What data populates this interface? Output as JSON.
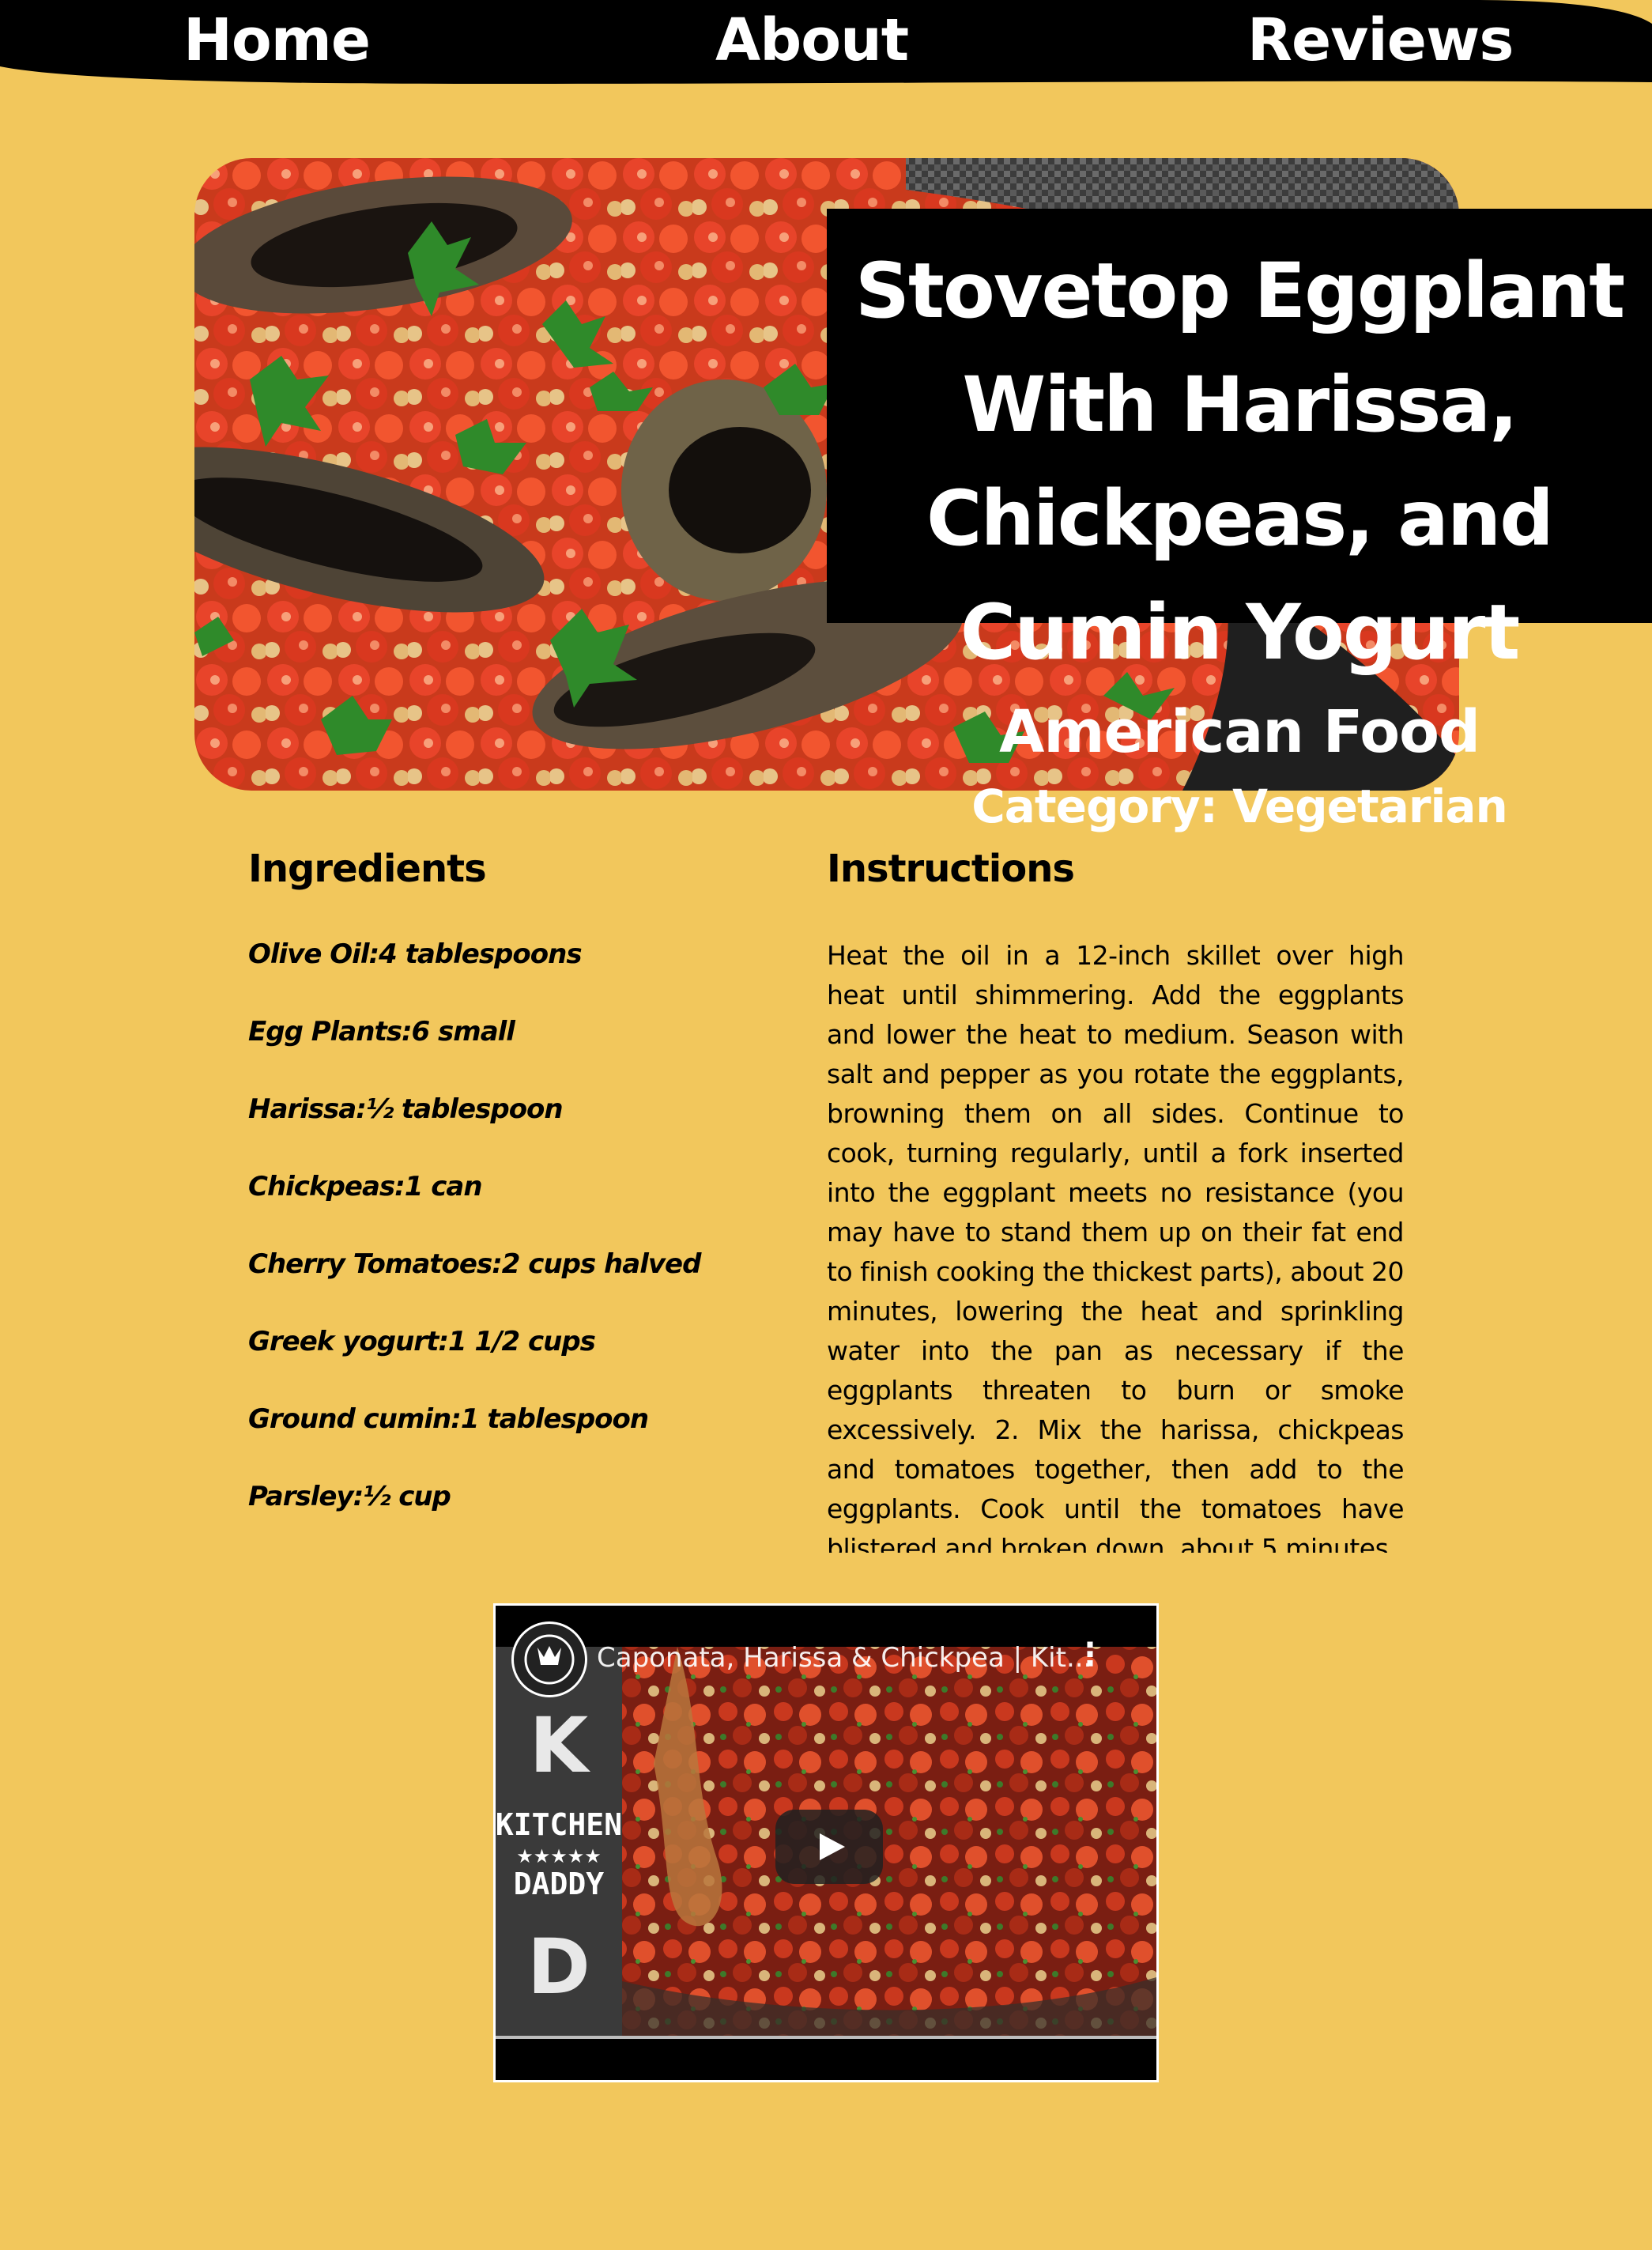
{
  "nav": {
    "home": "Home",
    "about": "About",
    "reviews": "Reviews"
  },
  "meal": {
    "title": "Stovetop Eggplant With Harissa, Chickpeas, and Cumin Yogurt",
    "area": "American Food",
    "category": "Category: Vegetarian"
  },
  "ingredients": {
    "heading": "Ingredients",
    "items": [
      "Olive Oil:4 tablespoons",
      "Egg Plants:6 small",
      "Harissa:½ tablespoon",
      "Chickpeas:1 can",
      "Cherry Tomatoes:2 cups halved",
      "Greek yogurt:1 1/2 cups",
      "Ground cumin:1 tablespoon",
      "Parsley:½ cup"
    ]
  },
  "instructions": {
    "heading": "Instructions",
    "text": "Heat the oil in a 12-inch skillet over high heat until shimmering. Add the eggplants and lower the heat to medium. Season with salt and pepper as you rotate the eggplants, browning them on all sides. Continue to cook, turning regularly, until a fork inserted into the eggplant meets no resistance (you may have to stand them up on their fat end to finish cooking the thickest parts), about 20 minutes, lowering the heat and sprinkling water into the pan as necessary if the eggplants threaten to burn or smoke excessively. 2. Mix the harissa, chickpeas and tomatoes together, then add to the eggplants. Cook until the tomatoes have blistered and broken down, about 5 minutes."
  },
  "video": {
    "title": "Caponata, Harissa & Chickpea | Kit...",
    "menu_icon": "more-vertical-icon",
    "play_icon": "play-icon",
    "channel_icon": "channel-logo-icon"
  },
  "colors": {
    "background": "#f2c75c",
    "nav": "#000000",
    "title_box": "#000000",
    "text_light": "#ffffff"
  }
}
